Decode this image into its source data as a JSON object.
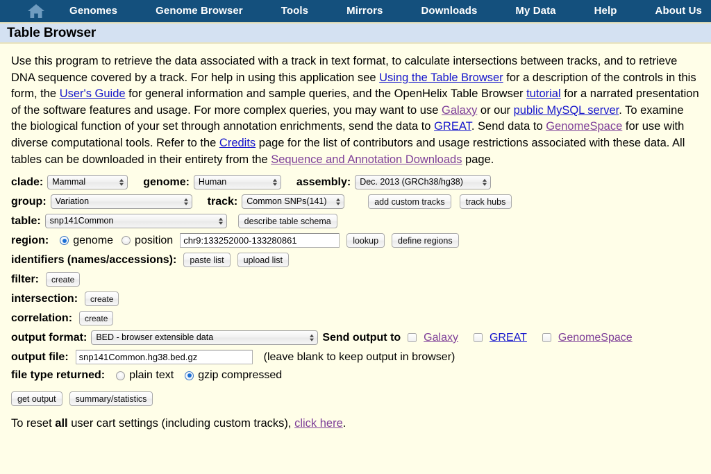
{
  "nav": {
    "home_icon": "home-icon",
    "items": [
      {
        "label": "Genomes"
      },
      {
        "label": "Genome Browser"
      },
      {
        "label": "Tools"
      },
      {
        "label": "Mirrors"
      },
      {
        "label": "Downloads"
      },
      {
        "label": "My Data"
      },
      {
        "label": "Help"
      },
      {
        "label": "About Us"
      }
    ]
  },
  "page": {
    "title": "Table Browser"
  },
  "intro": {
    "t1": "Use this program to retrieve the data associated with a track in text format, to calculate intersections between tracks, and to retrieve DNA sequence covered by a track. For help in using this application see ",
    "link_using": "Using the Table Browser",
    "t2": " for a description of the controls in this form, the ",
    "link_users_guide": "User's Guide",
    "t3": " for general information and sample queries, and the OpenHelix Table Browser ",
    "link_tutorial": "tutorial",
    "t4": " for a narrated presentation of the software features and usage. For more complex queries, you may want to use ",
    "link_galaxy": "Galaxy",
    "t5": " or our ",
    "link_mysql": "public MySQL server",
    "t6": ". To examine the biological function of your set through annotation enrichments, send the data to ",
    "link_great": "GREAT",
    "t7": ". Send data to ",
    "link_genomespace": "GenomeSpace",
    "t8": " for use with diverse computational tools. Refer to the ",
    "link_credits": "Credits",
    "t9": " page for the list of contributors and usage restrictions associated with these data. All tables can be downloaded in their entirety from the ",
    "link_downloads": "Sequence and Annotation Downloads",
    "t10": " page."
  },
  "form": {
    "clade_label": "clade:",
    "clade_value": "Mammal",
    "genome_label": "genome:",
    "genome_value": "Human",
    "assembly_label": "assembly:",
    "assembly_value": "Dec. 2013 (GRCh38/hg38)",
    "group_label": "group:",
    "group_value": "Variation",
    "track_label": "track:",
    "track_value": "Common SNPs(141)",
    "add_custom_tracks": "add custom tracks",
    "track_hubs": "track hubs",
    "table_label": "table:",
    "table_value": "snp141Common",
    "describe_table_schema": "describe table schema",
    "region_label": "region:",
    "region_genome_label": "genome",
    "region_position_label": "position",
    "region_position_value": "chr9:133252000-133280861",
    "region_selected": "genome",
    "lookup": "lookup",
    "define_regions": "define regions",
    "identifiers_label": "identifiers (names/accessions):",
    "paste_list": "paste list",
    "upload_list": "upload list",
    "filter_label": "filter:",
    "filter_create": "create",
    "intersection_label": "intersection:",
    "intersection_create": "create",
    "correlation_label": "correlation:",
    "correlation_create": "create",
    "output_format_label": "output format:",
    "output_format_value": "BED - browser extensible data",
    "send_output_to": "Send output to",
    "send_galaxy": "Galaxy",
    "send_great": "GREAT",
    "send_genomespace": "GenomeSpace",
    "output_file_label": "output file:",
    "output_file_value": "snp141Common.hg38.bed.gz",
    "output_file_hint": "(leave blank to keep output in browser)",
    "file_type_label": "file type returned:",
    "file_type_plain": "plain text",
    "file_type_gzip": "gzip compressed",
    "file_type_selected": "gzip compressed",
    "get_output": "get output",
    "summary_statistics": "summary/statistics"
  },
  "footer": {
    "reset_a": "To reset ",
    "reset_all": "all",
    "reset_b": " user cart settings (including custom tracks), ",
    "reset_link": "click here",
    "reset_c": "."
  },
  "colors": {
    "nav_bg": "#14507d",
    "title_bg": "#d4e1f2",
    "page_bg": "#fffee8",
    "link": "#1515cc",
    "visited_link": "#7e3f98",
    "accent_radio": "#1a6fd4"
  }
}
